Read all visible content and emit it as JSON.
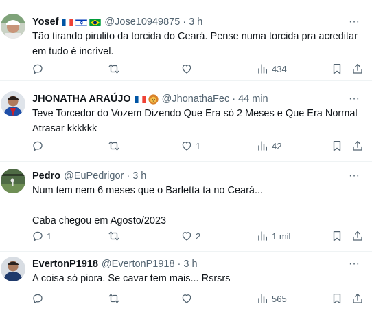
{
  "tweets": [
    {
      "name": "Yosef",
      "flags": [
        "france-flag",
        "israel-flag",
        "brazil-flag"
      ],
      "handle": "@Jose10949875",
      "time": "3 h",
      "text": "Tão tirando pirulito da torcida do Ceará. Pense numa torcida pra acreditar em tudo é incrível.",
      "replies": "",
      "retweets": "",
      "likes": "",
      "views": "434"
    },
    {
      "name": "JHONATHA ARAÚJO",
      "flags": [
        "france-flag",
        "lion-emoji"
      ],
      "handle": "@JhonathaFec",
      "time": "44 min",
      "text": "Teve Torcedor do Vozem Dizendo Que Era só 2 Meses e Que Era Normal Atrasar kkkkkk",
      "replies": "",
      "retweets": "",
      "likes": "1",
      "views": "42"
    },
    {
      "name": "Pedro",
      "flags": [],
      "handle": "@EuPedrigor",
      "time": "3 h",
      "text": "Num tem nem 6 meses que o Barletta ta no Ceará...\n\nCaba chegou em Agosto/2023",
      "replies": "1",
      "retweets": "",
      "likes": "2",
      "views": "1 mil"
    },
    {
      "name": "EvertonP1918",
      "flags": [],
      "handle": "@EvertonP1918",
      "time": "3 h",
      "text": "A coisa só piora. Se cavar tem mais... Rsrsrs",
      "replies": "",
      "retweets": "",
      "likes": "",
      "views": "565"
    }
  ],
  "separator": "·",
  "more_glyph": "···",
  "colors": {
    "text": "#0f1419",
    "muted": "#536471",
    "divider": "#eff3f4"
  }
}
